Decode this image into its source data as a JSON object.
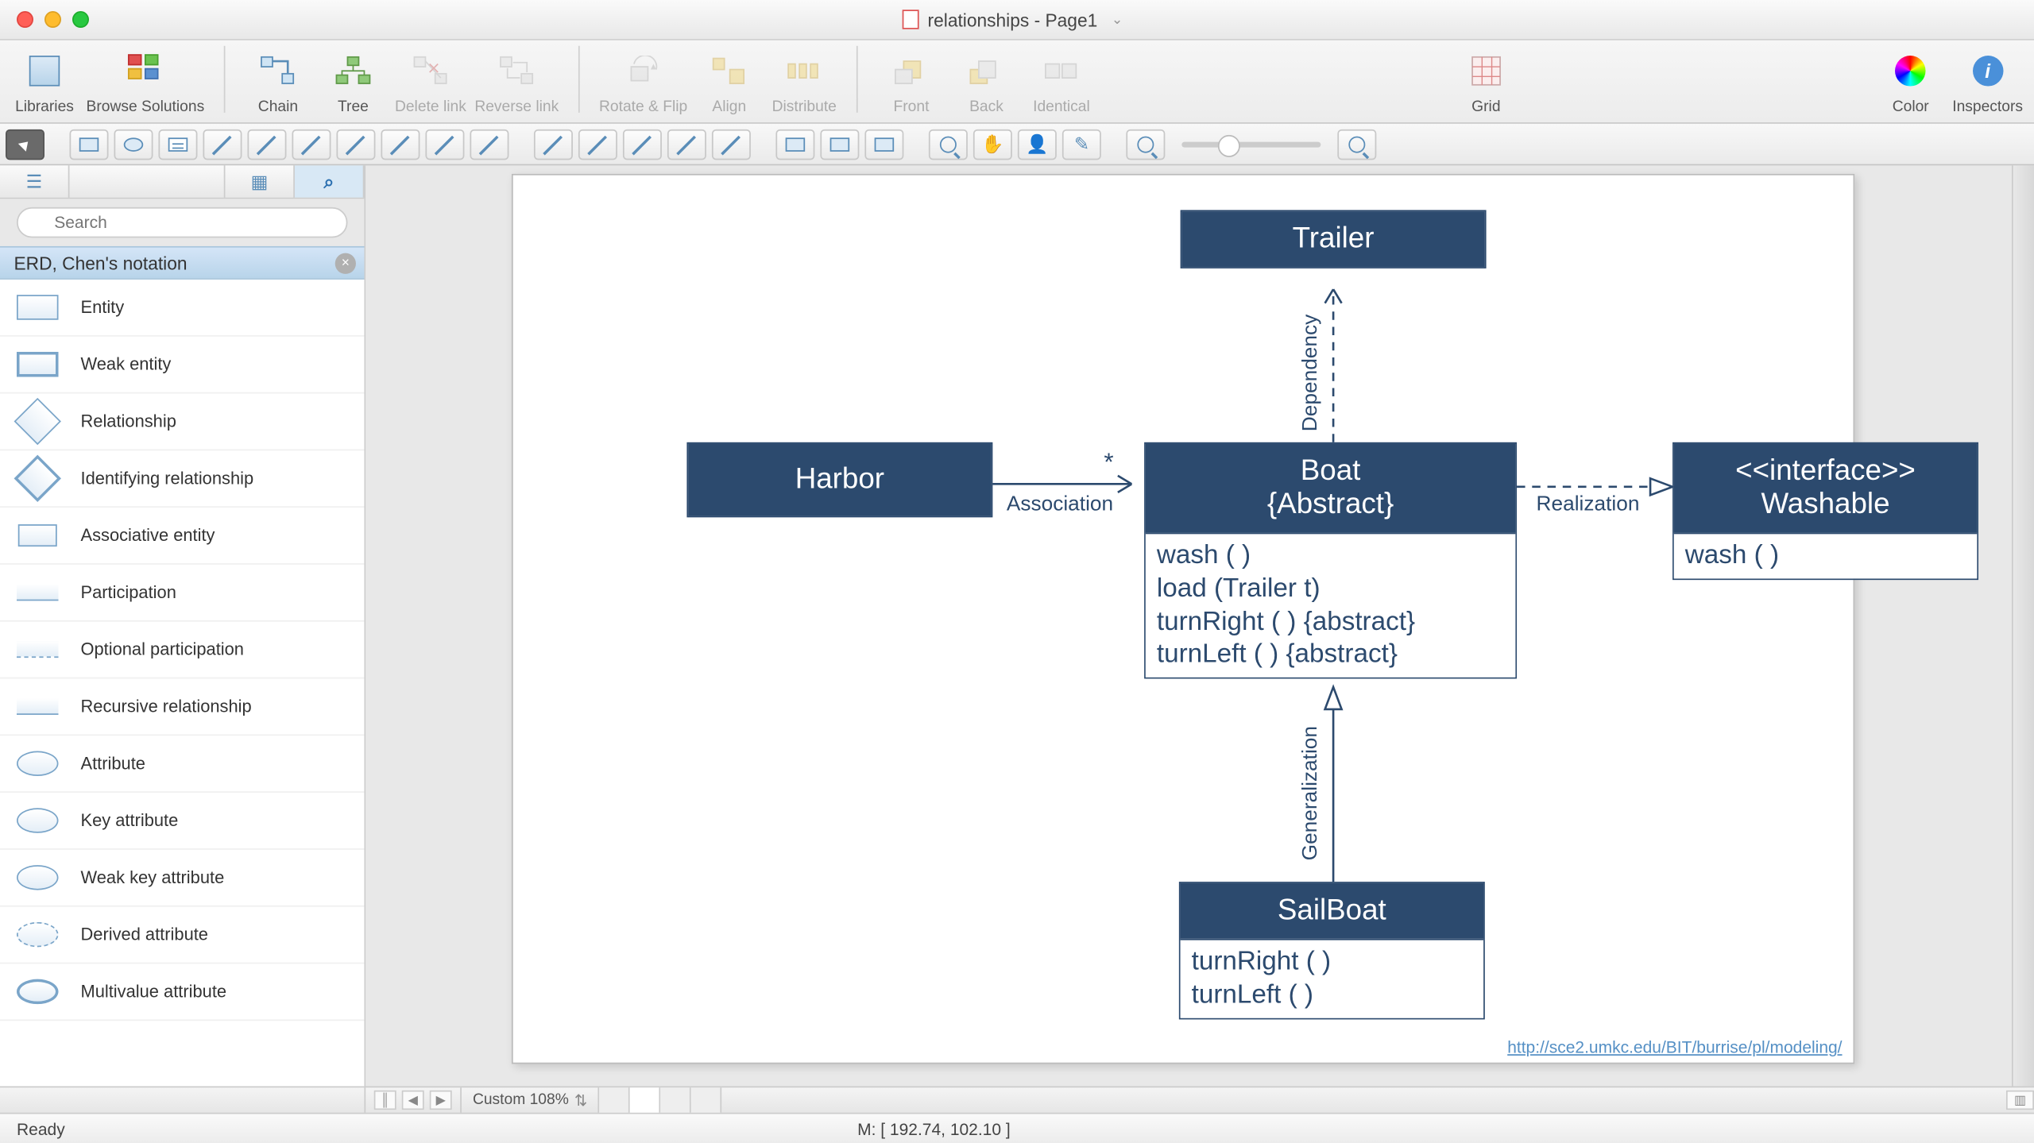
{
  "titlebar": {
    "title": "relationships - Page1"
  },
  "toolbar": {
    "libraries": "Libraries",
    "browse": "Browse Solutions",
    "chain": "Chain",
    "tree": "Tree",
    "delete_link": "Delete link",
    "reverse_link": "Reverse link",
    "rotate_flip": "Rotate & Flip",
    "align": "Align",
    "distribute": "Distribute",
    "front": "Front",
    "back": "Back",
    "identical": "Identical",
    "grid": "Grid",
    "color": "Color",
    "inspectors": "Inspectors"
  },
  "sidebar": {
    "search_placeholder": "Search",
    "section_title": "ERD, Chen's notation",
    "items": [
      {
        "label": "Entity"
      },
      {
        "label": "Weak entity"
      },
      {
        "label": "Relationship"
      },
      {
        "label": "Identifying relationship"
      },
      {
        "label": "Associative entity"
      },
      {
        "label": "Participation"
      },
      {
        "label": "Optional participation"
      },
      {
        "label": "Recursive relationship"
      },
      {
        "label": "Attribute"
      },
      {
        "label": "Key attribute"
      },
      {
        "label": "Weak key attribute"
      },
      {
        "label": "Derived attribute"
      },
      {
        "label": "Multivalue attribute"
      }
    ]
  },
  "diagram": {
    "trailer": {
      "name": "Trailer"
    },
    "harbor": {
      "name": "Harbor"
    },
    "boat": {
      "name": "Boat",
      "stereo": "{Abstract}",
      "methods": [
        "wash ( )",
        "load (Trailer t)",
        "turnRight ( ) {abstract}",
        "turnLeft ( ) {abstract}"
      ]
    },
    "washable": {
      "stereo": "<<interface>>",
      "name": "Washable",
      "methods": [
        "wash ( )"
      ]
    },
    "sailboat": {
      "name": "SailBoat",
      "methods": [
        "turnRight ( )",
        "turnLeft ( )"
      ]
    },
    "labels": {
      "association": "Association",
      "star": "*",
      "dependency": "Dependency",
      "realization": "Realization",
      "generalization": "Generalization"
    },
    "url": "http://sce2.umkc.edu/BIT/burrise/pl/modeling/"
  },
  "bottom": {
    "zoom": "Custom 108%"
  },
  "status": {
    "ready": "Ready",
    "coords": "M: [ 192.74, 102.10 ]"
  },
  "chart_data": {
    "type": "uml_class_diagram",
    "classes": [
      {
        "name": "Trailer",
        "kind": "class",
        "methods": []
      },
      {
        "name": "Harbor",
        "kind": "class",
        "methods": []
      },
      {
        "name": "Boat",
        "kind": "abstract_class",
        "methods": [
          "wash()",
          "load(Trailer t)",
          "turnRight() {abstract}",
          "turnLeft() {abstract}"
        ]
      },
      {
        "name": "Washable",
        "kind": "interface",
        "methods": [
          "wash()"
        ]
      },
      {
        "name": "SailBoat",
        "kind": "class",
        "methods": [
          "turnRight()",
          "turnLeft()"
        ]
      }
    ],
    "relationships": [
      {
        "from": "Harbor",
        "to": "Boat",
        "type": "association",
        "multiplicity_to": "*"
      },
      {
        "from": "Boat",
        "to": "Trailer",
        "type": "dependency"
      },
      {
        "from": "Boat",
        "to": "Washable",
        "type": "realization"
      },
      {
        "from": "SailBoat",
        "to": "Boat",
        "type": "generalization"
      }
    ],
    "source_url": "http://sce2.umkc.edu/BIT/burrise/pl/modeling/"
  }
}
